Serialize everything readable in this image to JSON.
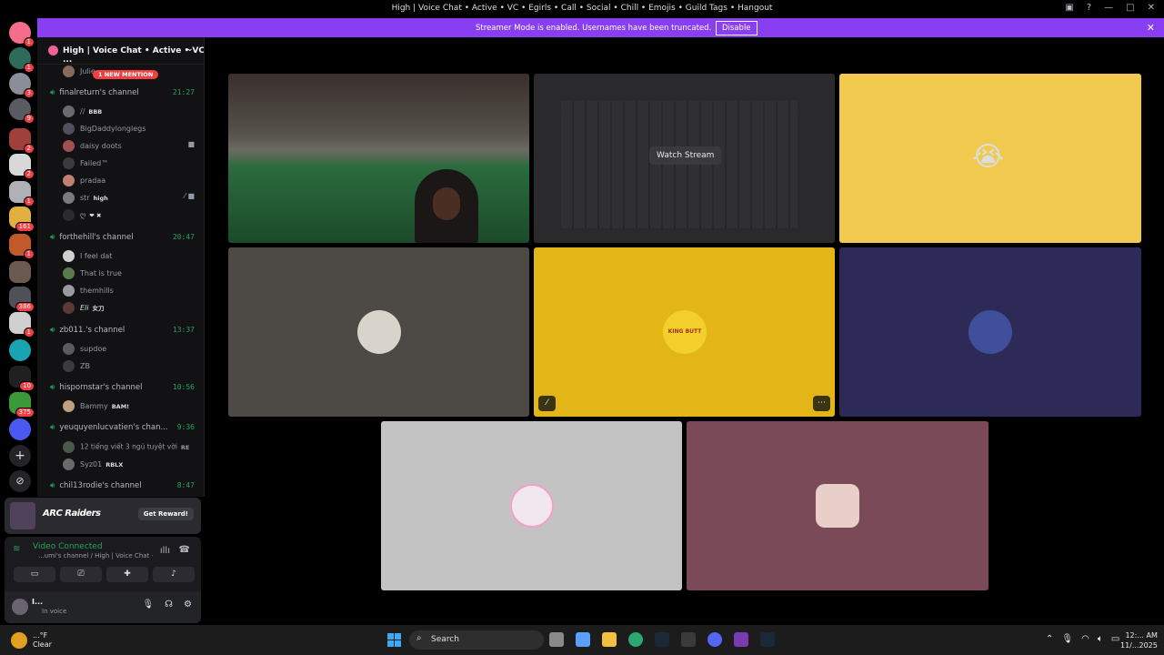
{
  "window": {
    "title": "High | Voice Chat • Active • VC • Egirls • Call • Social • Chill • Emojis • Guild Tags • Hangout"
  },
  "banner": {
    "message": "Streamer Mode is enabled. Usernames have been truncated.",
    "disable_label": "Disable"
  },
  "rail_badges": [
    "1",
    "1",
    "3",
    "9",
    "2",
    "2",
    "1",
    "161",
    "1",
    "1",
    "386",
    "1",
    "10",
    "375"
  ],
  "server": {
    "name": "High | Voice Chat • Active • VC ..."
  },
  "mention_pill": "1 NEW MENTION",
  "partial_user": "Julie...",
  "channels": [
    {
      "name": "finalreturn's channel",
      "time": "21:27",
      "users": [
        {
          "name": "//",
          "tag": "BBB"
        },
        {
          "name": "BigDaddylonglegs",
          "tag": ""
        },
        {
          "name": "daisy doots",
          "tag": ""
        },
        {
          "name": "Failed™",
          "tag": ""
        },
        {
          "name": "pradaa",
          "tag": ""
        },
        {
          "name": "str",
          "tag": "high"
        },
        {
          "name": "ღ",
          "tag": "❤ ✖"
        }
      ]
    },
    {
      "name": "forthehill's channel",
      "time": "20:47",
      "users": [
        {
          "name": "I feel dat",
          "tag": ""
        },
        {
          "name": "That is true",
          "tag": ""
        },
        {
          "name": "themhills",
          "tag": ""
        },
        {
          "name": "Eli",
          "tag": "女刀"
        }
      ]
    },
    {
      "name": "zb011.'s channel",
      "time": "13:37",
      "users": [
        {
          "name": "supdoe",
          "tag": ""
        },
        {
          "name": "ZB",
          "tag": ""
        }
      ]
    },
    {
      "name": "hispornstar's channel",
      "time": "10:56",
      "users": [
        {
          "name": "Bammy",
          "tag": "BAM!"
        }
      ]
    },
    {
      "name": "yeuquyenlucvatien's chan...",
      "time": "9:36",
      "users": [
        {
          "name": "12 tiếng viết 3 ngủ tuyệt vời",
          "tag": "RE"
        },
        {
          "name": "Syz01",
          "tag": "RBLX"
        }
      ]
    },
    {
      "name": "chil13rodie's channel",
      "time": "8:47",
      "users": []
    }
  ],
  "promo": {
    "logo": "ARC Raiders",
    "button": "Get Reward!"
  },
  "voice": {
    "status": "Video Connected",
    "sub": "...umi's channel / High | Voice Chat • Acti..."
  },
  "me": {
    "name": "I...",
    "status": "In voice"
  },
  "stream": {
    "watch_label": "Watch Stream"
  },
  "tile_texts": {
    "gold_avatar_text": "KING BUTT"
  },
  "taskbar": {
    "weather_temp": "...°F",
    "weather_desc": "Clear",
    "search": "Search",
    "time": "12:... AM",
    "date": "11/...2025"
  },
  "colors": {
    "accent": "#8a3ef2",
    "voice_green": "#23a55a",
    "mention_red": "#f23f43"
  }
}
